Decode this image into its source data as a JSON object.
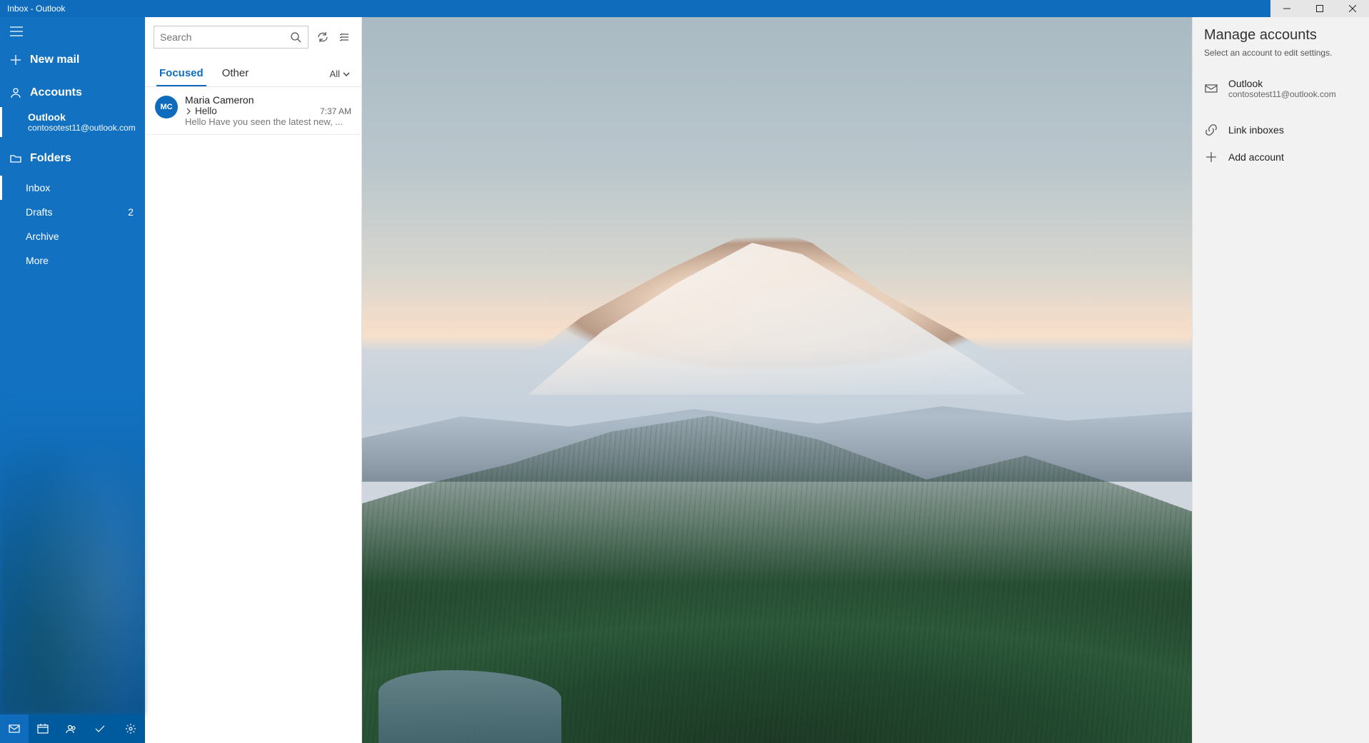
{
  "window": {
    "title": "Inbox - Outlook"
  },
  "sidebar": {
    "new_mail": "New mail",
    "accounts_header": "Accounts",
    "account": {
      "name": "Outlook",
      "email": "contosotest11@outlook.com"
    },
    "folders_header": "Folders",
    "folders": [
      {
        "label": "Inbox",
        "count": ""
      },
      {
        "label": "Drafts",
        "count": "2"
      },
      {
        "label": "Archive",
        "count": ""
      },
      {
        "label": "More",
        "count": ""
      }
    ]
  },
  "msglist": {
    "search_placeholder": "Search",
    "tabs": {
      "focused": "Focused",
      "other": "Other"
    },
    "filter": "All",
    "messages": [
      {
        "initials": "MC",
        "from": "Maria Cameron",
        "subject": "Hello",
        "time": "7:37 AM",
        "preview": "Hello Have you seen the latest new, ..."
      }
    ]
  },
  "rightpanel": {
    "title": "Manage accounts",
    "subtitle": "Select an account to edit settings.",
    "account": {
      "name": "Outlook",
      "email": "contosotest11@outlook.com"
    },
    "link_inboxes": "Link inboxes",
    "add_account": "Add account"
  }
}
